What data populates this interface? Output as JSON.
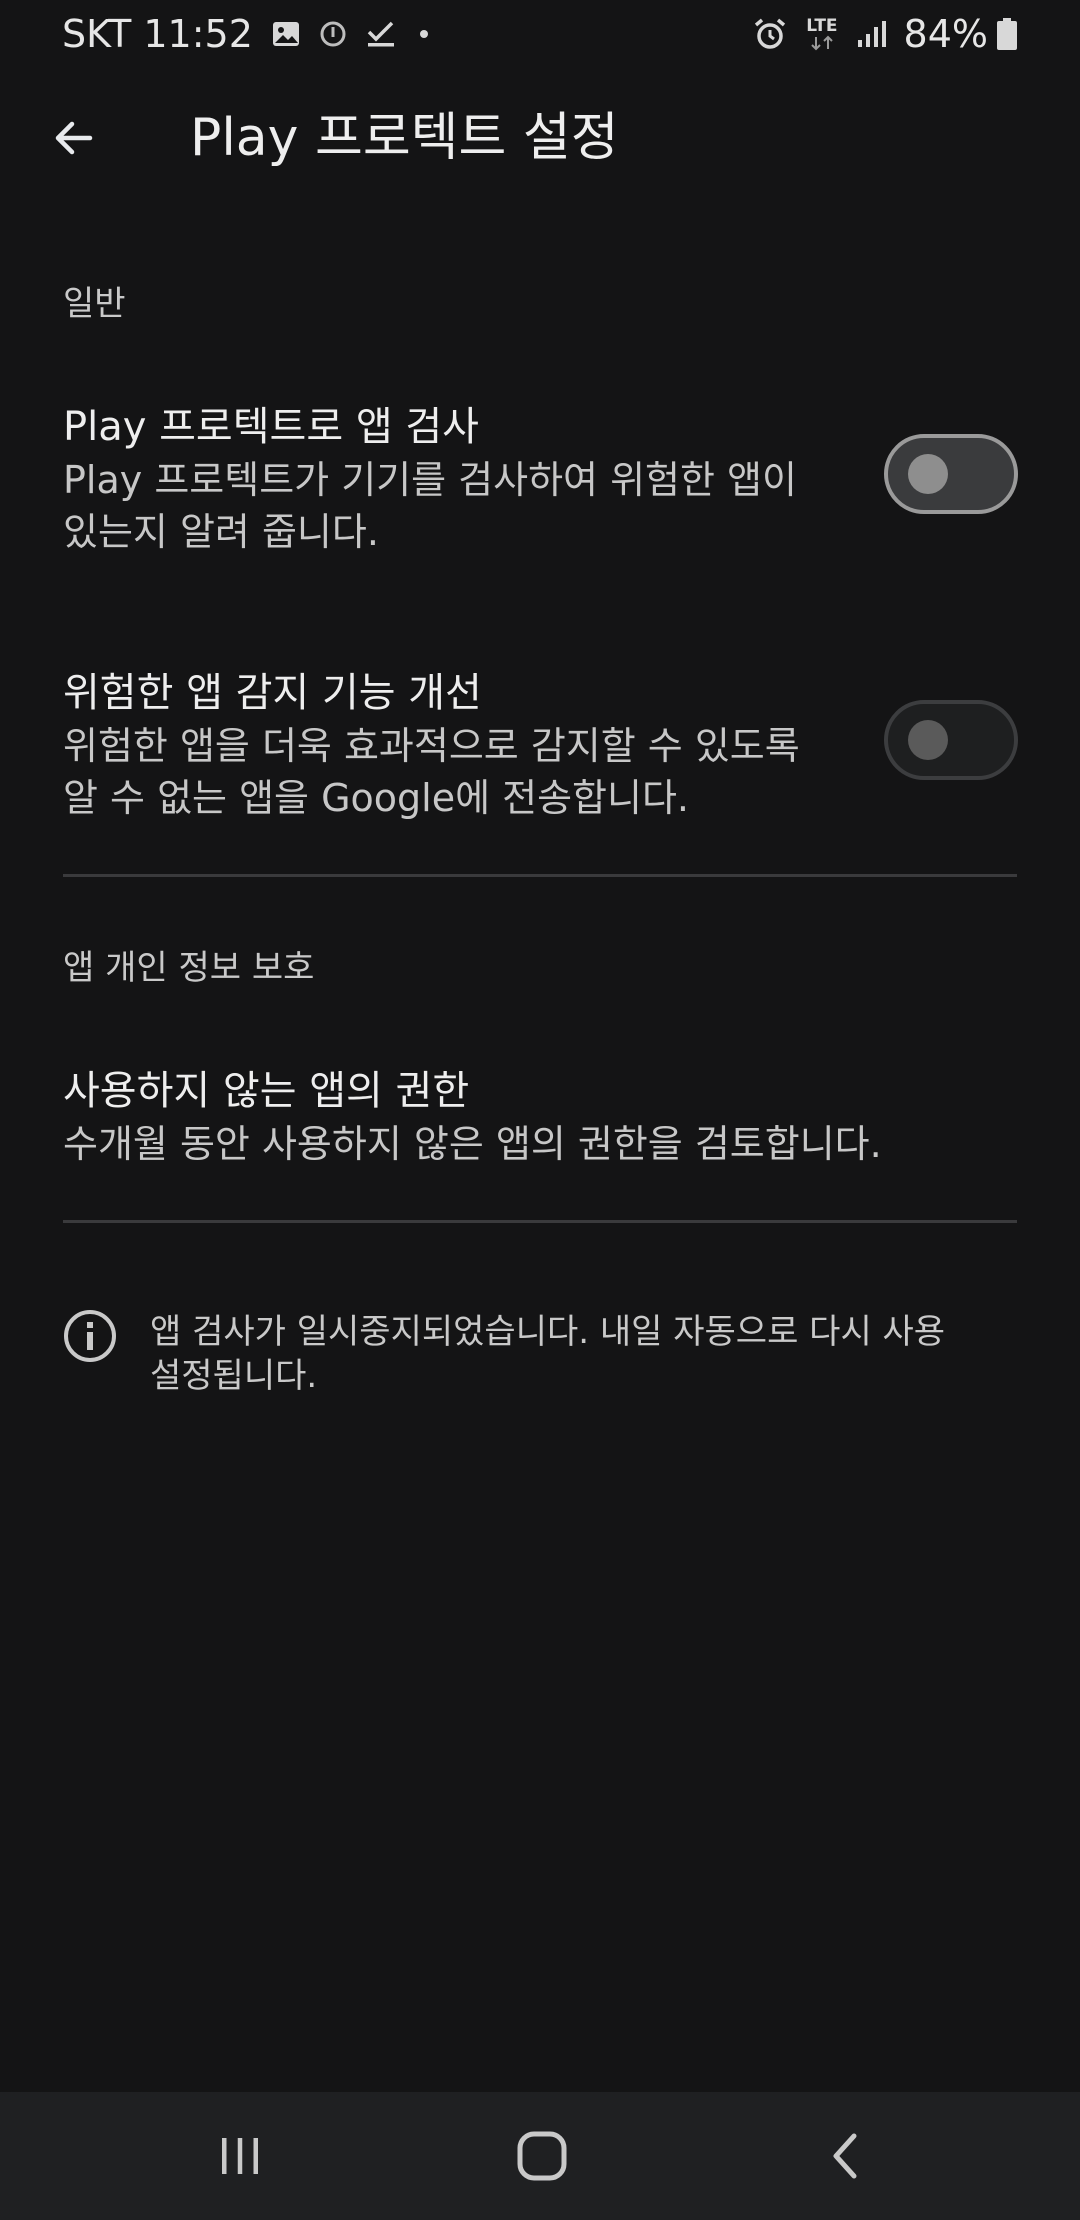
{
  "status_bar": {
    "carrier_time": "SKT 11:52",
    "network_label": "LTE",
    "battery": "84%",
    "icons": [
      "gallery-icon",
      "alert-circle-icon",
      "check-download-icon",
      "dot-icon",
      "alarm-icon",
      "lte-icon",
      "signal-icon",
      "battery-icon"
    ]
  },
  "toolbar": {
    "title": "Play 프로텍트 설정",
    "back_icon": "arrow-left-icon"
  },
  "sections": {
    "general_header": "일반",
    "privacy_header": "앱 개인 정보 보호"
  },
  "settings": {
    "scan_apps": {
      "title": "Play 프로텍트로 앱 검사",
      "desc_line1": "Play 프로텍트가 기기를 검사하여 위험한 앱이",
      "desc_line2": "있는지 알려 줍니다.",
      "enabled": false
    },
    "improve_detection": {
      "title": "위험한 앱 감지 기능 개선",
      "desc_line1": "위험한 앱을 더욱 효과적으로 감지할 수 있도록",
      "desc_line2": "알 수 없는 앱을 Google에 전송합니다.",
      "enabled": false
    },
    "unused_permissions": {
      "title": "사용하지 않는 앱의 권한",
      "desc": "수개월 동안 사용하지 않은 앱의 권한을 검토합니다."
    }
  },
  "info": {
    "line1": "앱 검사가 일시중지되었습니다. 내일 자동으로 다시 사용",
    "line2": "설정됩니다."
  },
  "nav_bar": {
    "icons": [
      "recents-icon",
      "home-icon",
      "back-icon"
    ]
  },
  "colors": {
    "background": "#141415",
    "nav_background": "#1f2022",
    "divider": "#3a3a3c"
  }
}
